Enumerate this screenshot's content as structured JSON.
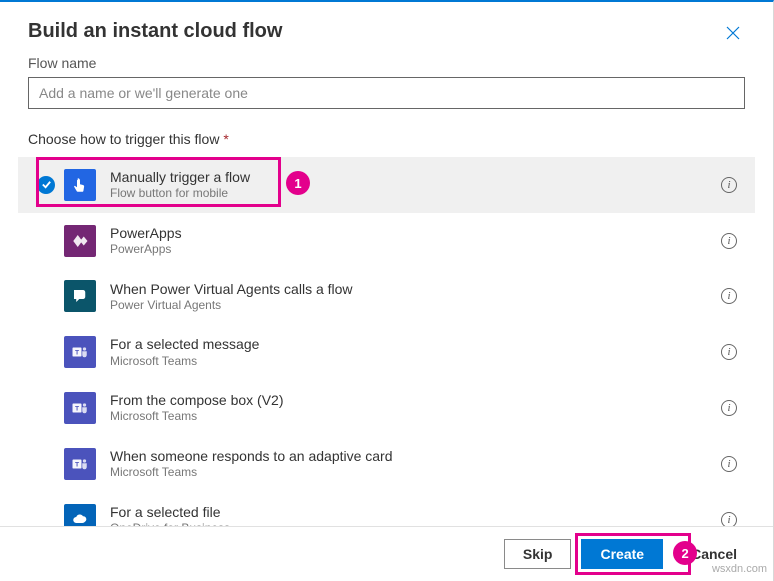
{
  "header": {
    "title": "Build an instant cloud flow"
  },
  "flow_name": {
    "label": "Flow name",
    "placeholder": "Add a name or we'll generate one"
  },
  "trigger_label": "Choose how to trigger this flow",
  "required_mark": "*",
  "triggers": [
    {
      "title": "Manually trigger a flow",
      "subtitle": "Flow button for mobile",
      "color": "#2266e3",
      "icon": "touch"
    },
    {
      "title": "PowerApps",
      "subtitle": "PowerApps",
      "color": "#742774",
      "icon": "powerapps"
    },
    {
      "title": "When Power Virtual Agents calls a flow",
      "subtitle": "Power Virtual Agents",
      "color": "#0b556a",
      "icon": "pva"
    },
    {
      "title": "For a selected message",
      "subtitle": "Microsoft Teams",
      "color": "#4b53bc",
      "icon": "teams"
    },
    {
      "title": "From the compose box (V2)",
      "subtitle": "Microsoft Teams",
      "color": "#4b53bc",
      "icon": "teams"
    },
    {
      "title": "When someone responds to an adaptive card",
      "subtitle": "Microsoft Teams",
      "color": "#4b53bc",
      "icon": "teams"
    },
    {
      "title": "For a selected file",
      "subtitle": "OneDrive for Business",
      "color": "#0364b8",
      "icon": "onedrive"
    }
  ],
  "annotations": {
    "callout1": "1",
    "callout2": "2"
  },
  "footer": {
    "skip": "Skip",
    "create": "Create",
    "cancel": "Cancel"
  },
  "watermark": "wsxdn.com"
}
